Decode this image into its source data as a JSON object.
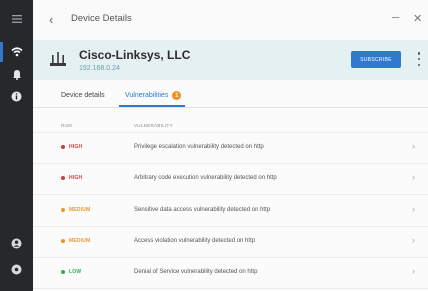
{
  "window": {
    "title": "Device Details"
  },
  "device": {
    "name": "Cisco-Linksys, LLC",
    "ip": "192.168.0.24",
    "subscribe_label": "SUBSCRIBE"
  },
  "tabs": [
    {
      "label": "Device details"
    },
    {
      "label": "Vulnerabilities",
      "badge": "1"
    }
  ],
  "table": {
    "headers": {
      "risk": "RISK",
      "vulnerability": "VULNERABILITY"
    },
    "rows": [
      {
        "risk": "HIGH",
        "vulnerability": "Privilege escalation vulnerability detected on http"
      },
      {
        "risk": "HIGH",
        "vulnerability": "Arbitrary code execution vulnerability detected on http"
      },
      {
        "risk": "MEDIUM",
        "vulnerability": "Sensitive data access vulnerability detected on http"
      },
      {
        "risk": "MEDIUM",
        "vulnerability": "Access violation vulnerability detected on http"
      },
      {
        "risk": "LOW",
        "vulnerability": "Denial of Service vulnerability detected on http"
      }
    ]
  },
  "colors": {
    "accent": "#2f79d0",
    "badge": "#f28c1e",
    "risk_high": "#d23b3b",
    "risk_medium": "#e8962e",
    "risk_low": "#35a55a",
    "rail": "#26282c",
    "header_bg": "#e4f0f2"
  },
  "icons": {
    "rail": [
      "menu-icon",
      "network-icon",
      "bell-icon",
      "info-icon",
      "account-icon",
      "help-icon"
    ],
    "device": "router-icon"
  }
}
